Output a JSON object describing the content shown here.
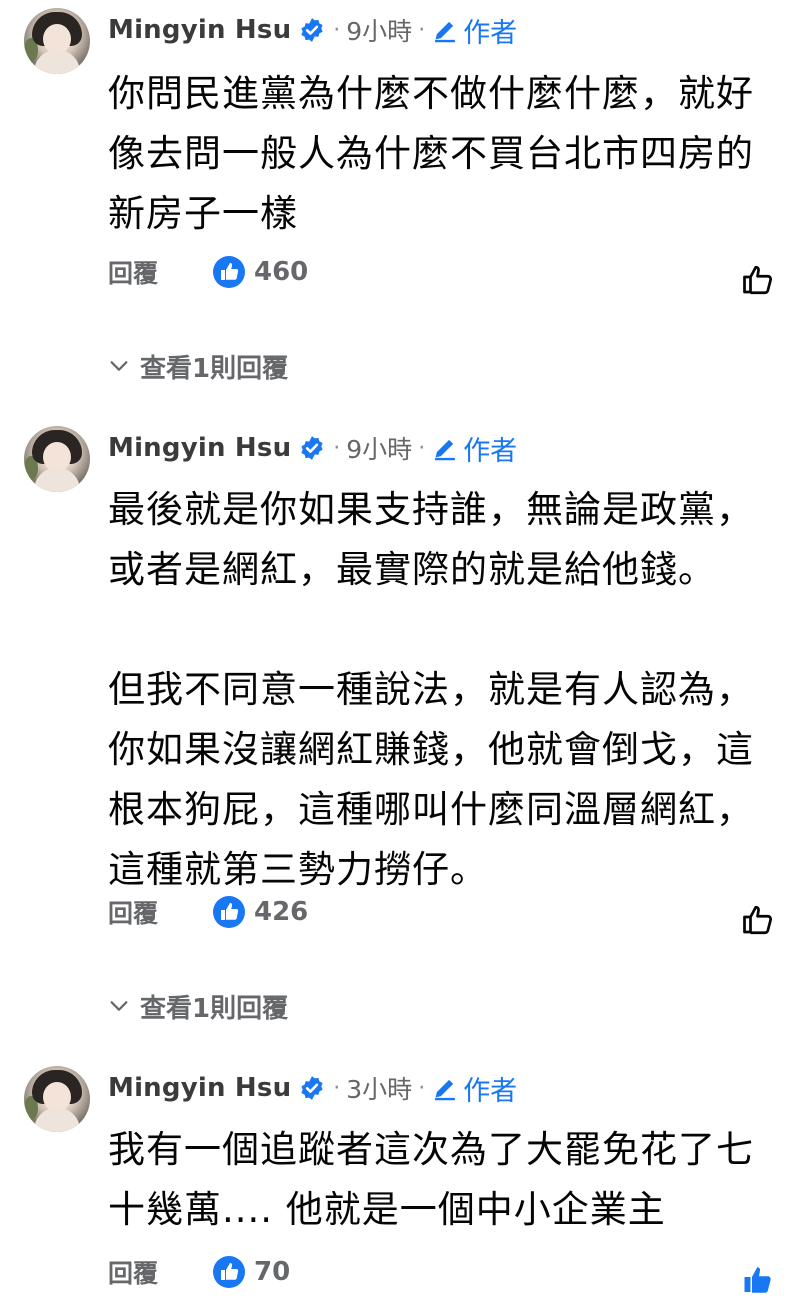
{
  "comments": [
    {
      "author": "Mingyin Hsu",
      "time": "9小時",
      "author_badge": "作者",
      "text": "你問民進黨為什麼不做什麼什麼，就好\n像去問一般人為什麼不買台北市四房的\n新房子一樣",
      "reply_label": "回覆",
      "likes": "460",
      "view_replies": "查看1則回覆",
      "liked": false
    },
    {
      "author": "Mingyin Hsu",
      "time": "9小時",
      "author_badge": "作者",
      "text": "最後就是你如果支持誰，無論是政黨，\n或者是網紅，最實際的就是給他錢。\n\n但我不同意一種說法，就是有人認為，\n你如果沒讓網紅賺錢，他就會倒戈，這\n根本狗屁，這種哪叫什麼同溫層網紅，\n這種就第三勢力撈仔。",
      "reply_label": "回覆",
      "likes": "426",
      "view_replies": "查看1則回覆",
      "liked": false
    },
    {
      "author": "Mingyin Hsu",
      "time": "3小時",
      "author_badge": "作者",
      "text": "我有一個追蹤者這次為了大罷免花了七\n十幾萬.... 他就是一個中小企業主",
      "reply_label": "回覆",
      "likes": "70",
      "liked": true
    }
  ],
  "colors": {
    "accent": "#1877f2",
    "secondary_text": "#65676b",
    "primary_text": "#050505"
  },
  "icons": {
    "verified": "verified-badge-icon",
    "author": "pencil-icon",
    "like_reaction": "thumbs-up-reaction-icon",
    "like_button": "thumbs-up-outline-icon",
    "like_button_active": "thumbs-up-filled-icon",
    "expand": "chevron-down-icon"
  }
}
